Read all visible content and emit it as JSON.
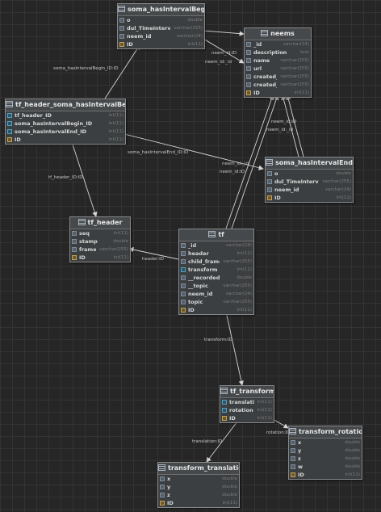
{
  "tables": {
    "soma_begin": {
      "name": "soma_hasIntervalBegin",
      "columns": [
        {
          "name": "o",
          "type": "double",
          "icon": "column-icon"
        },
        {
          "name": "dul_TimeInterval_s",
          "type": "varchar(255)",
          "icon": "column-icon"
        },
        {
          "name": "neem_id",
          "type": "varchar(24)",
          "icon": "column-icon"
        },
        {
          "name": "ID",
          "type": "int(11)",
          "icon": "key-icon"
        }
      ]
    },
    "neems": {
      "name": "neems",
      "columns": [
        {
          "name": "_id",
          "type": "varchar(24)",
          "icon": "column-icon"
        },
        {
          "name": "description",
          "type": "text",
          "icon": "column-icon"
        },
        {
          "name": "name",
          "type": "varchar(255)",
          "icon": "column-icon"
        },
        {
          "name": "url",
          "type": "varchar(255)",
          "icon": "column-icon"
        },
        {
          "name": "created_at",
          "type": "varchar(255)",
          "icon": "column-icon"
        },
        {
          "name": "created_by",
          "type": "varchar(255)",
          "icon": "column-icon"
        },
        {
          "name": "ID",
          "type": "int(11)",
          "icon": "key-icon"
        }
      ]
    },
    "tf_header_soma": {
      "name": "tf_header_soma_hasIntervalBegin",
      "columns": [
        {
          "name": "tf_header_ID",
          "type": "int(11)",
          "icon": "foreign-key-icon"
        },
        {
          "name": "soma_hasIntervalBegin_ID",
          "type": "int(11)",
          "icon": "foreign-key-icon"
        },
        {
          "name": "soma_hasIntervalEnd_ID",
          "type": "int(11)",
          "icon": "foreign-key-icon"
        },
        {
          "name": "ID",
          "type": "int(11)",
          "icon": "key-icon"
        }
      ]
    },
    "soma_end": {
      "name": "soma_hasIntervalEnd",
      "columns": [
        {
          "name": "o",
          "type": "double",
          "icon": "column-icon"
        },
        {
          "name": "dul_TimeInterval_s",
          "type": "varchar(255)",
          "icon": "column-icon"
        },
        {
          "name": "neem_id",
          "type": "varchar(24)",
          "icon": "column-icon"
        },
        {
          "name": "ID",
          "type": "int(11)",
          "icon": "key-icon"
        }
      ]
    },
    "tf_header": {
      "name": "tf_header",
      "columns": [
        {
          "name": "seq",
          "type": "int(11)",
          "icon": "column-icon"
        },
        {
          "name": "stamp",
          "type": "double",
          "icon": "column-icon"
        },
        {
          "name": "frame_id",
          "type": "varchar(255)",
          "icon": "column-icon"
        },
        {
          "name": "ID",
          "type": "int(11)",
          "icon": "key-icon"
        }
      ]
    },
    "tf": {
      "name": "tf",
      "columns": [
        {
          "name": "_id",
          "type": "varchar(24)",
          "icon": "column-icon"
        },
        {
          "name": "header",
          "type": "int(11)",
          "icon": "column-icon"
        },
        {
          "name": "child_frame_id",
          "type": "varchar(255)",
          "icon": "column-icon"
        },
        {
          "name": "transform",
          "type": "int(11)",
          "icon": "foreign-key-icon"
        },
        {
          "name": "__recorded",
          "type": "double",
          "icon": "column-icon"
        },
        {
          "name": "__topic",
          "type": "varchar(255)",
          "icon": "column-icon"
        },
        {
          "name": "neem_id",
          "type": "varchar(24)",
          "icon": "column-icon"
        },
        {
          "name": "topic",
          "type": "varchar(255)",
          "icon": "column-icon"
        },
        {
          "name": "ID",
          "type": "int(11)",
          "icon": "key-icon"
        }
      ]
    },
    "tf_transform": {
      "name": "tf_transform",
      "columns": [
        {
          "name": "translation",
          "type": "int(11)",
          "icon": "foreign-key-icon"
        },
        {
          "name": "rotation",
          "type": "int(11)",
          "icon": "foreign-key-icon"
        },
        {
          "name": "ID",
          "type": "int(11)",
          "icon": "key-icon"
        }
      ]
    },
    "transform_rotation": {
      "name": "transform_rotation",
      "columns": [
        {
          "name": "x",
          "type": "double",
          "icon": "column-icon"
        },
        {
          "name": "y",
          "type": "double",
          "icon": "column-icon"
        },
        {
          "name": "z",
          "type": "double",
          "icon": "column-icon"
        },
        {
          "name": "w",
          "type": "double",
          "icon": "column-icon"
        },
        {
          "name": "ID",
          "type": "int(11)",
          "icon": "key-icon"
        }
      ]
    },
    "transform_translation": {
      "name": "transform_translation",
      "columns": [
        {
          "name": "x",
          "type": "double",
          "icon": "column-icon"
        },
        {
          "name": "y",
          "type": "double",
          "icon": "column-icon"
        },
        {
          "name": "z",
          "type": "double",
          "icon": "column-icon"
        },
        {
          "name": "ID",
          "type": "int(11)",
          "icon": "key-icon"
        }
      ]
    }
  },
  "relations": [
    {
      "label": "neem_id:ID",
      "from": "soma_begin",
      "to": "neems"
    },
    {
      "label": "neem_id:_id",
      "from": "soma_begin",
      "to": "neems"
    },
    {
      "label": "soma_hasIntervalBegin_ID:ID",
      "from": "tf_header_soma",
      "to": "soma_begin"
    },
    {
      "label": "soma_hasIntervalEnd_ID:ID",
      "from": "tf_header_soma",
      "to": "soma_end"
    },
    {
      "label": "tf_header_ID:ID",
      "from": "tf_header_soma",
      "to": "tf_header"
    },
    {
      "label": "neem_id:ID",
      "from": "soma_end",
      "to": "neems"
    },
    {
      "label": "neem_id:_id",
      "from": "soma_end",
      "to": "neems"
    },
    {
      "label": "neem_id:_id",
      "from": "tf",
      "to": "neems"
    },
    {
      "label": "neem_id:ID",
      "from": "tf",
      "to": "neems"
    },
    {
      "label": "header:ID",
      "from": "tf",
      "to": "tf_header"
    },
    {
      "label": "transform:ID",
      "from": "tf",
      "to": "tf_transform"
    },
    {
      "label": "rotation:ID",
      "from": "tf_transform",
      "to": "transform_rotation"
    },
    {
      "label": "translation:ID",
      "from": "tf_transform",
      "to": "transform_translation"
    }
  ],
  "colors": {
    "background": "#262626",
    "table_fill": "#3c3f41",
    "table_border": "#8a8a8a",
    "edge": "#d4d4d4"
  }
}
